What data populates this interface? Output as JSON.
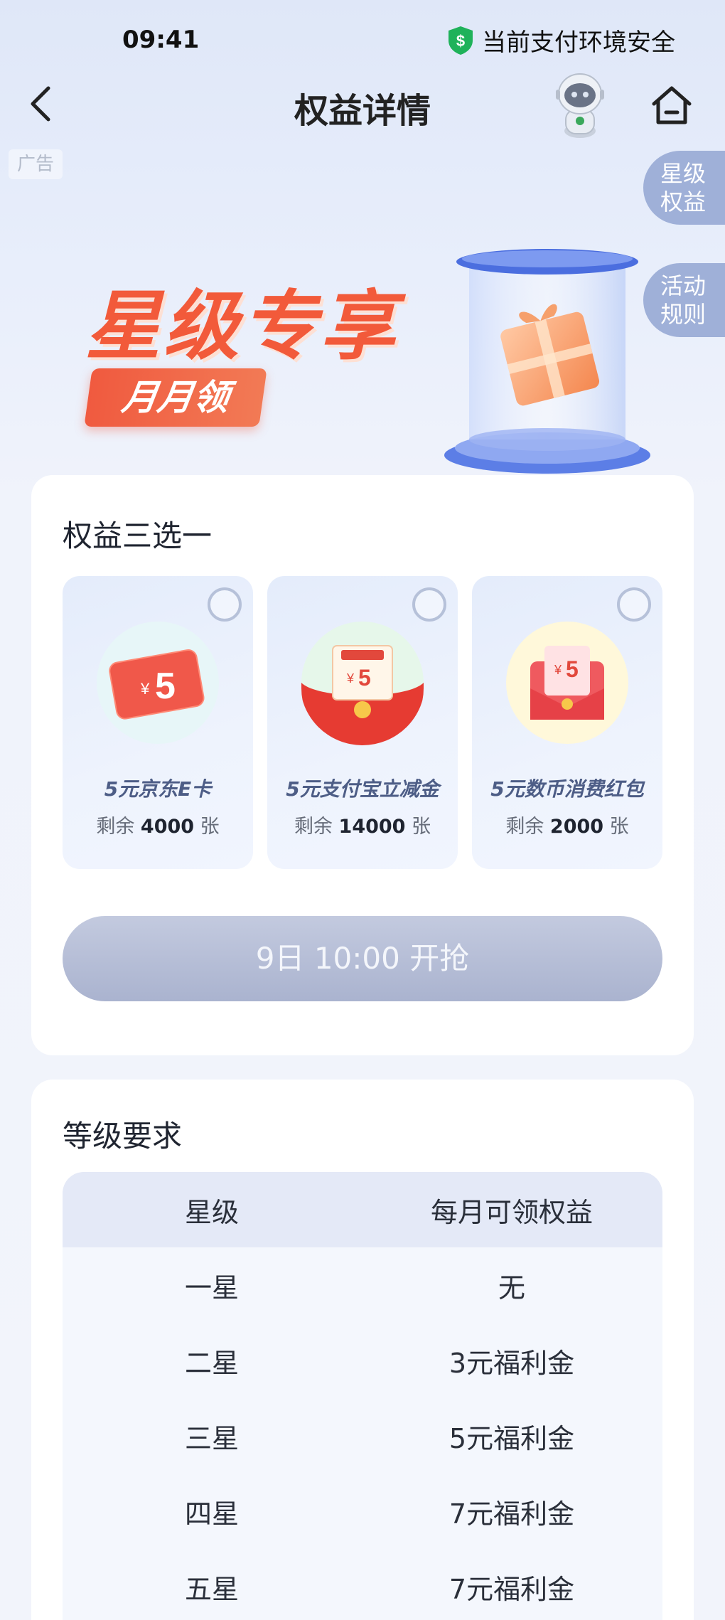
{
  "status_bar": {
    "time": "09:41",
    "safety_text": "当前支付环境安全"
  },
  "nav": {
    "title": "权益详情"
  },
  "ad_tag": "广告",
  "side_tabs": [
    {
      "line1": "星级",
      "line2": "权益"
    },
    {
      "line1": "活动",
      "line2": "规则"
    }
  ],
  "banner": {
    "title": "星级专享",
    "pill": "月月领"
  },
  "choose_card": {
    "title": "权益三选一",
    "options": [
      {
        "name": "5元京东E卡",
        "remain_prefix": "剩余",
        "remain_count": "4000",
        "remain_unit": "张",
        "icon": "jd-card-icon",
        "price": "5",
        "currency": "¥"
      },
      {
        "name": "5元支付宝立减金",
        "remain_prefix": "剩余",
        "remain_count": "14000",
        "remain_unit": "张",
        "icon": "alipay-envelope-icon",
        "price": "5",
        "currency": "¥"
      },
      {
        "name": "5元数币消费红包",
        "remain_prefix": "剩余",
        "remain_count": "2000",
        "remain_unit": "张",
        "icon": "red-envelope-icon",
        "price": "5",
        "currency": "¥"
      }
    ],
    "grab_button": "9日 10:00 开抢"
  },
  "level_card": {
    "title": "等级要求",
    "headers": [
      "星级",
      "每月可领权益"
    ],
    "rows": [
      [
        "一星",
        "无"
      ],
      [
        "二星",
        "3元福利金"
      ],
      [
        "三星",
        "5元福利金"
      ],
      [
        "四星",
        "7元福利金"
      ],
      [
        "五星",
        "7元福利金"
      ]
    ]
  },
  "colors": {
    "accent_red": "#f25a3a",
    "button_disabled": "#aab3cf",
    "side_tab": "#9fb0d8",
    "shield_green": "#1fb25a"
  }
}
